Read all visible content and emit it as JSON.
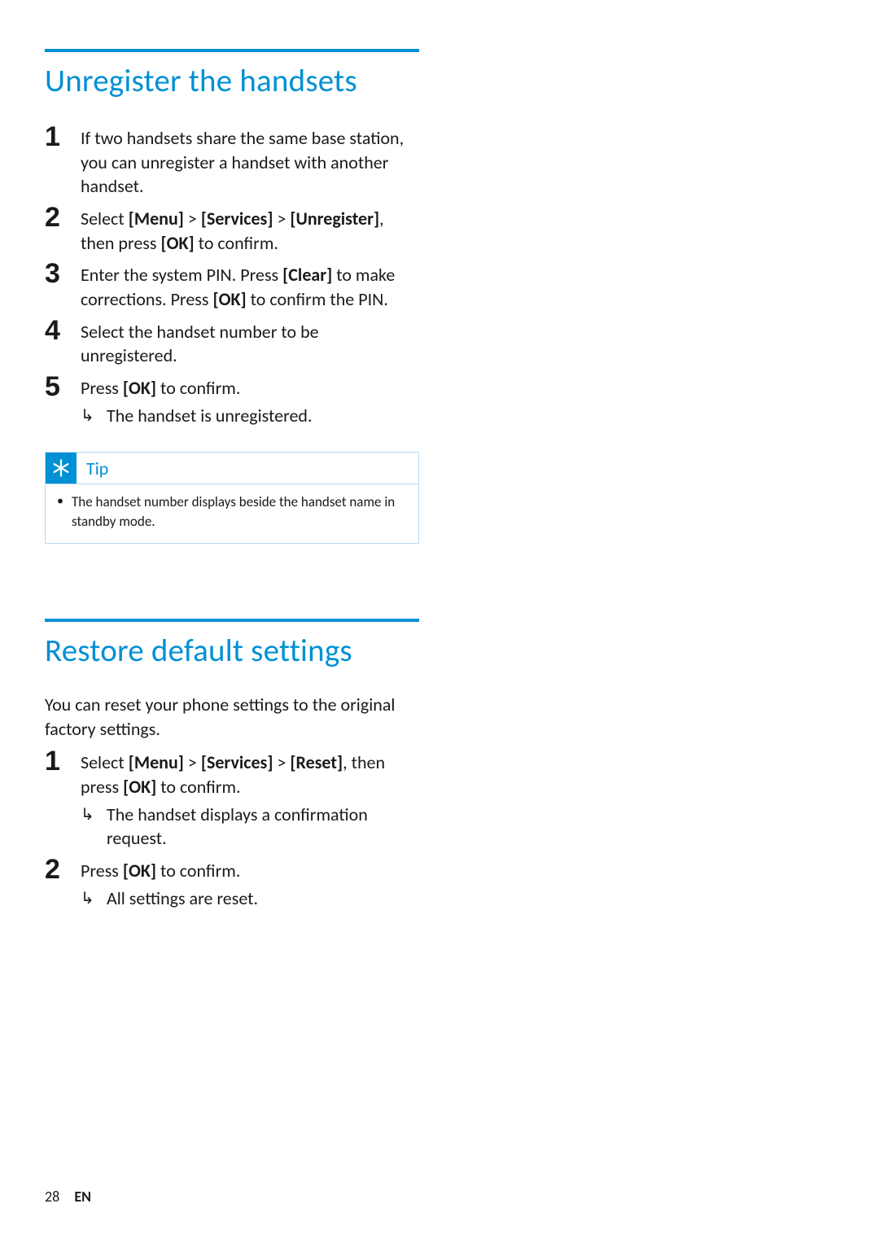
{
  "sections": {
    "unregister": {
      "title": "Unregister the handsets",
      "steps": [
        {
          "num": "1",
          "body": "If two handsets share the same base station, you can unregister a handset with another handset."
        },
        {
          "num": "2",
          "body_parts": [
            "Select ",
            "[Menu]",
            " > ",
            "[Services]",
            " > ",
            "[Unregister]",
            ", then press ",
            "[OK]",
            " to confirm."
          ]
        },
        {
          "num": "3",
          "body_parts": [
            "Enter the system PIN. Press ",
            "[Clear]",
            " to make corrections. Press ",
            "[OK]",
            " to confirm the PIN."
          ]
        },
        {
          "num": "4",
          "body": "Select the handset number to be unregistered."
        },
        {
          "num": "5",
          "body_parts": [
            "Press ",
            "[OK]",
            " to confirm."
          ],
          "result": "The handset is unregistered."
        }
      ]
    },
    "restore": {
      "title": "Restore default settings",
      "intro": "You can reset your phone settings to the original factory settings.",
      "steps": [
        {
          "num": "1",
          "body_parts": [
            "Select ",
            "[Menu]",
            " > ",
            "[Services]",
            " > ",
            "[Reset]",
            ", then press ",
            "[OK]",
            " to confirm."
          ],
          "result": "The handset displays a confirmation request."
        },
        {
          "num": "2",
          "body_parts": [
            "Press ",
            "[OK]",
            " to confirm."
          ],
          "result": "All settings are reset."
        }
      ]
    }
  },
  "tip": {
    "label": "Tip",
    "text": "The handset number displays beside the handset name in standby mode."
  },
  "footer": {
    "page": "28",
    "lang": "EN"
  },
  "glyphs": {
    "result_arrow": "↳",
    "bullet": "•"
  }
}
